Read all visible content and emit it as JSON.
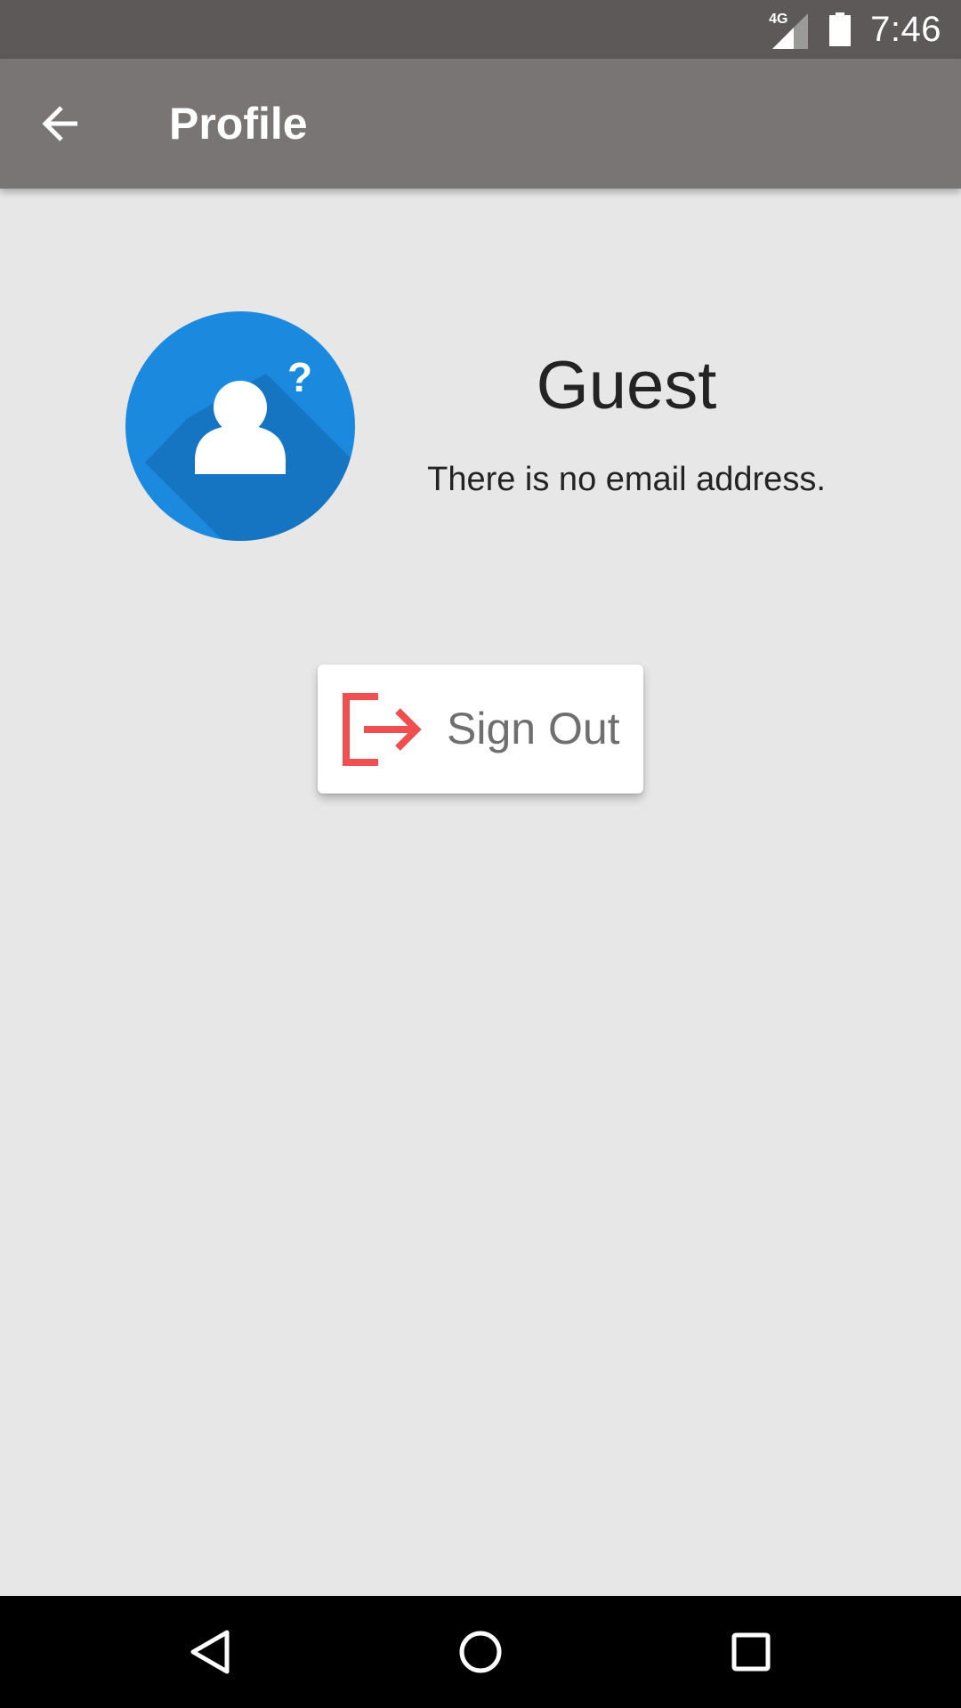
{
  "status_bar": {
    "network_type": "4G",
    "time": "7:46",
    "icons": [
      "signal-icon",
      "battery-icon"
    ]
  },
  "app_bar": {
    "title": "Profile",
    "back_icon": "arrow-back-icon"
  },
  "profile": {
    "name": "Guest",
    "email_text": "There is no email address.",
    "avatar_icon": "unknown-user-icon",
    "avatar_color": "#1b89dd"
  },
  "actions": {
    "sign_out_label": "Sign Out",
    "sign_out_icon": "sign-out-icon",
    "sign_out_icon_color": "#ef4f51"
  },
  "nav_bar": {
    "icons": [
      "nav-back-icon",
      "nav-home-icon",
      "nav-recents-icon"
    ]
  },
  "colors": {
    "status_bar": "#5d5959",
    "app_bar": "#7a7575",
    "background": "#e7e7e8"
  }
}
